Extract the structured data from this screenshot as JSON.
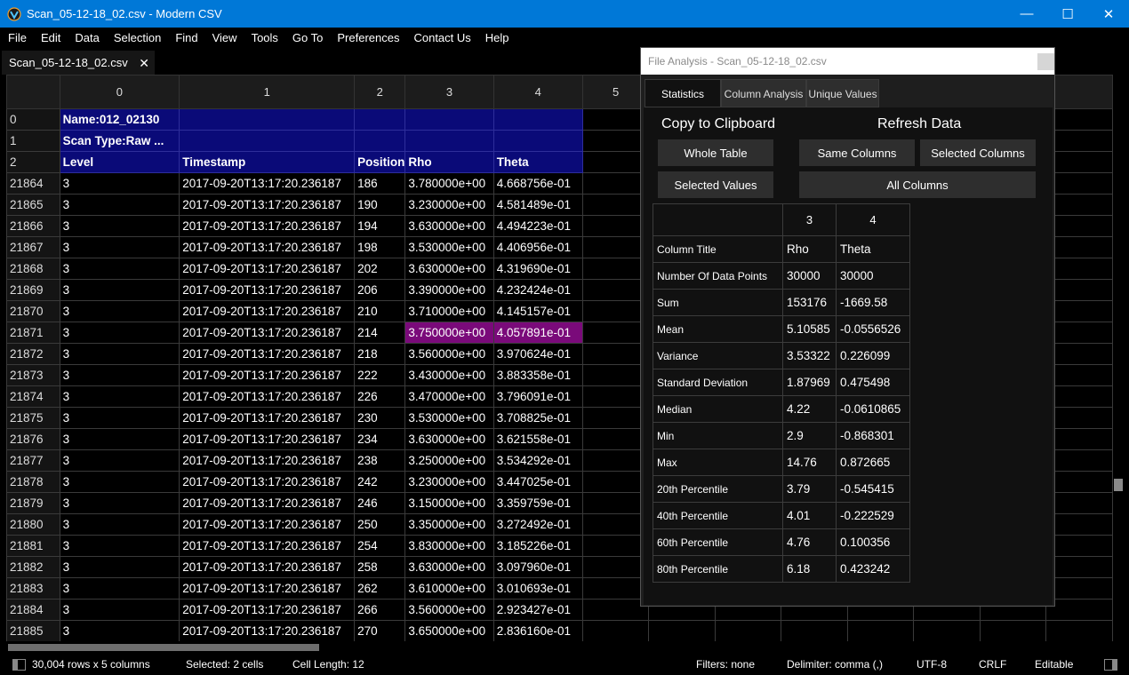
{
  "window": {
    "title": "Scan_05-12-18_02.csv - Modern CSV",
    "icon": "modern-csv-logo-icon",
    "controls": {
      "minimize": "—",
      "maximize": "☐",
      "close": "✕"
    }
  },
  "menu": [
    "File",
    "Edit",
    "Data",
    "Selection",
    "Find",
    "View",
    "Tools",
    "Go To",
    "Preferences",
    "Contact Us",
    "Help"
  ],
  "tab": {
    "label": "Scan_05-12-18_02.csv",
    "close": "✕"
  },
  "grid": {
    "column_headers": [
      "0",
      "1",
      "2",
      "3",
      "4",
      "5"
    ],
    "header_rows": [
      {
        "row": "0",
        "cells": [
          "Name:012_02130",
          "",
          "",
          "",
          ""
        ]
      },
      {
        "row": "1",
        "cells": [
          "Scan Type:Raw ...",
          "",
          "",
          "",
          ""
        ]
      },
      {
        "row": "2",
        "cells": [
          "Level",
          "Timestamp",
          "Position",
          "Rho",
          "Theta"
        ]
      }
    ],
    "rows": [
      {
        "row": "21864",
        "cells": [
          "3",
          "2017-09-20T13:17:20.236187",
          "186",
          "3.780000e+00",
          "4.668756e-01"
        ]
      },
      {
        "row": "21865",
        "cells": [
          "3",
          "2017-09-20T13:17:20.236187",
          "190",
          "3.230000e+00",
          "4.581489e-01"
        ]
      },
      {
        "row": "21866",
        "cells": [
          "3",
          "2017-09-20T13:17:20.236187",
          "194",
          "3.630000e+00",
          "4.494223e-01"
        ]
      },
      {
        "row": "21867",
        "cells": [
          "3",
          "2017-09-20T13:17:20.236187",
          "198",
          "3.530000e+00",
          "4.406956e-01"
        ]
      },
      {
        "row": "21868",
        "cells": [
          "3",
          "2017-09-20T13:17:20.236187",
          "202",
          "3.630000e+00",
          "4.319690e-01"
        ]
      },
      {
        "row": "21869",
        "cells": [
          "3",
          "2017-09-20T13:17:20.236187",
          "206",
          "3.390000e+00",
          "4.232424e-01"
        ]
      },
      {
        "row": "21870",
        "cells": [
          "3",
          "2017-09-20T13:17:20.236187",
          "210",
          "3.710000e+00",
          "4.145157e-01"
        ]
      },
      {
        "row": "21871",
        "cells": [
          "3",
          "2017-09-20T13:17:20.236187",
          "214",
          "3.750000e+00",
          "4.057891e-01"
        ],
        "selected": [
          3,
          4
        ]
      },
      {
        "row": "21872",
        "cells": [
          "3",
          "2017-09-20T13:17:20.236187",
          "218",
          "3.560000e+00",
          "3.970624e-01"
        ]
      },
      {
        "row": "21873",
        "cells": [
          "3",
          "2017-09-20T13:17:20.236187",
          "222",
          "3.430000e+00",
          "3.883358e-01"
        ]
      },
      {
        "row": "21874",
        "cells": [
          "3",
          "2017-09-20T13:17:20.236187",
          "226",
          "3.470000e+00",
          "3.796091e-01"
        ]
      },
      {
        "row": "21875",
        "cells": [
          "3",
          "2017-09-20T13:17:20.236187",
          "230",
          "3.530000e+00",
          "3.708825e-01"
        ]
      },
      {
        "row": "21876",
        "cells": [
          "3",
          "2017-09-20T13:17:20.236187",
          "234",
          "3.630000e+00",
          "3.621558e-01"
        ]
      },
      {
        "row": "21877",
        "cells": [
          "3",
          "2017-09-20T13:17:20.236187",
          "238",
          "3.250000e+00",
          "3.534292e-01"
        ]
      },
      {
        "row": "21878",
        "cells": [
          "3",
          "2017-09-20T13:17:20.236187",
          "242",
          "3.230000e+00",
          "3.447025e-01"
        ]
      },
      {
        "row": "21879",
        "cells": [
          "3",
          "2017-09-20T13:17:20.236187",
          "246",
          "3.150000e+00",
          "3.359759e-01"
        ]
      },
      {
        "row": "21880",
        "cells": [
          "3",
          "2017-09-20T13:17:20.236187",
          "250",
          "3.350000e+00",
          "3.272492e-01"
        ]
      },
      {
        "row": "21881",
        "cells": [
          "3",
          "2017-09-20T13:17:20.236187",
          "254",
          "3.830000e+00",
          "3.185226e-01"
        ]
      },
      {
        "row": "21882",
        "cells": [
          "3",
          "2017-09-20T13:17:20.236187",
          "258",
          "3.630000e+00",
          "3.097960e-01"
        ]
      },
      {
        "row": "21883",
        "cells": [
          "3",
          "2017-09-20T13:17:20.236187",
          "262",
          "3.610000e+00",
          "3.010693e-01"
        ]
      },
      {
        "row": "21884",
        "cells": [
          "3",
          "2017-09-20T13:17:20.236187",
          "266",
          "3.560000e+00",
          "2.923427e-01"
        ]
      },
      {
        "row": "21885",
        "cells": [
          "3",
          "2017-09-20T13:17:20.236187",
          "270",
          "3.650000e+00",
          "2.836160e-01"
        ]
      }
    ],
    "colors": {
      "header_row_bg": "#0a0a78",
      "selection_bg": "#7a0a7a"
    }
  },
  "status": {
    "size": "30,004 rows x 5 columns",
    "selected": "Selected: 2 cells",
    "cell_length": "Cell Length: 12",
    "filters": "Filters: none",
    "delimiter": "Delimiter: comma (,)",
    "encoding": "UTF-8",
    "line_ending": "CRLF",
    "mode": "Editable"
  },
  "dialog": {
    "title": "File Analysis - Scan_05-12-18_02.csv",
    "tabs": [
      "Statistics",
      "Column Analysis",
      "Unique Values"
    ],
    "copy_label": "Copy to Clipboard",
    "refresh_label": "Refresh Data",
    "buttons": {
      "whole_table": "Whole Table",
      "selected_values": "Selected Values",
      "same_columns": "Same Columns",
      "selected_columns": "Selected Columns",
      "all_columns": "All Columns"
    },
    "stats": {
      "columns": [
        "3",
        "4"
      ],
      "rows": [
        {
          "label": "Column Title",
          "values": [
            "Rho",
            "Theta"
          ]
        },
        {
          "label": "Number Of Data Points",
          "values": [
            "30000",
            "30000"
          ]
        },
        {
          "label": "Sum",
          "values": [
            "153176",
            "-1669.58"
          ]
        },
        {
          "label": "Mean",
          "values": [
            "5.10585",
            "-0.0556526"
          ]
        },
        {
          "label": "Variance",
          "values": [
            "3.53322",
            "0.226099"
          ]
        },
        {
          "label": "Standard Deviation",
          "values": [
            "1.87969",
            "0.475498"
          ]
        },
        {
          "label": "Median",
          "values": [
            "4.22",
            "-0.0610865"
          ]
        },
        {
          "label": "Min",
          "values": [
            "2.9",
            "-0.868301"
          ]
        },
        {
          "label": "Max",
          "values": [
            "14.76",
            "0.872665"
          ]
        },
        {
          "label": "20th Percentile",
          "values": [
            "3.79",
            "-0.545415"
          ]
        },
        {
          "label": "40th Percentile",
          "values": [
            "4.01",
            "-0.222529"
          ]
        },
        {
          "label": "60th Percentile",
          "values": [
            "4.76",
            "0.100356"
          ]
        },
        {
          "label": "80th Percentile",
          "values": [
            "6.18",
            "0.423242"
          ]
        }
      ]
    }
  }
}
